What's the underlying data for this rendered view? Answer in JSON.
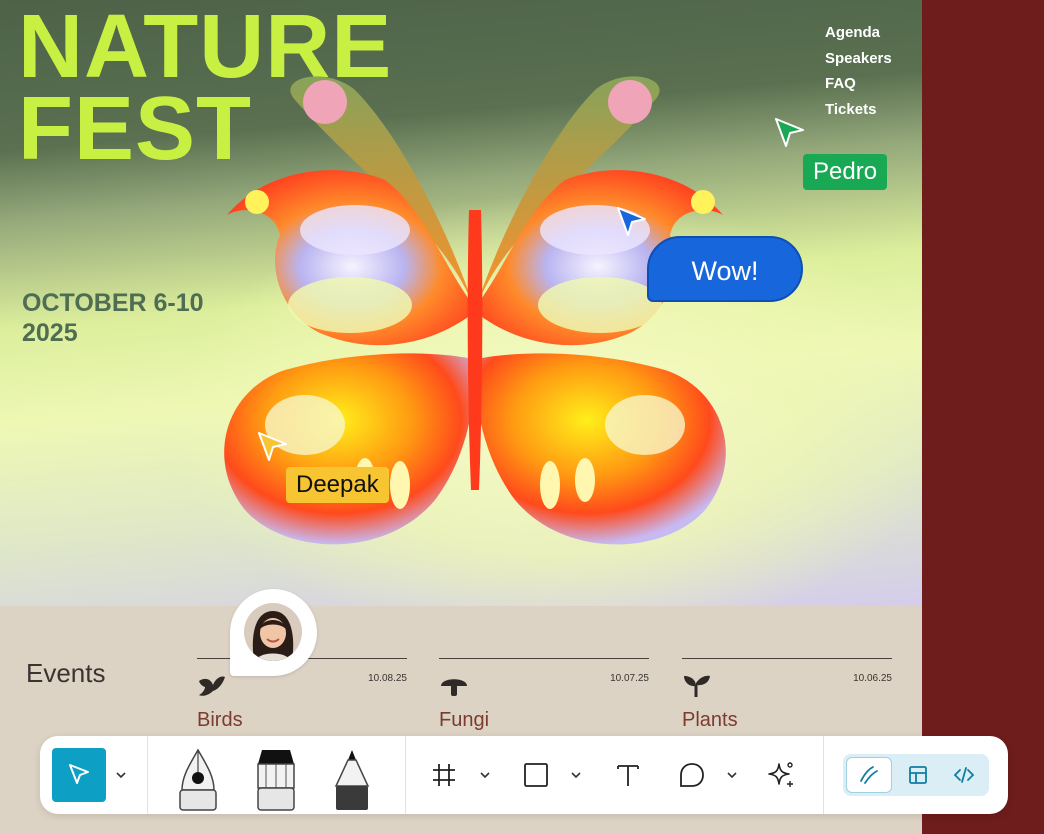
{
  "hero": {
    "title_line1": "NATURE",
    "title_line2": "FEST",
    "date_line1": "OCTOBER 6-10",
    "date_line2": "2025",
    "nav": [
      "Agenda",
      "Speakers",
      "FAQ",
      "Tickets"
    ]
  },
  "collaborators": {
    "pedro_label": "Pedro",
    "deepak_label": "Deepak",
    "comment_text": "Wow!",
    "pedro_color": "#19a854",
    "deepak_color": "#f7c531",
    "comment_color": "#1766dc"
  },
  "events": {
    "heading": "Events",
    "items": [
      {
        "name": "Birds",
        "date": "10.08.25",
        "icon": "bird-icon"
      },
      {
        "name": "Fungi",
        "date": "10.07.25",
        "icon": "mushroom-icon"
      },
      {
        "name": "Plants",
        "date": "10.06.25",
        "icon": "plant-icon"
      }
    ]
  },
  "toolbar": {
    "accent": "#0e9fc4",
    "tools": [
      "cursor-icon",
      "pen-icon",
      "brush-icon",
      "pencil-icon",
      "frame-icon",
      "rectangle-icon",
      "text-icon",
      "comment-icon",
      "ai-sparkle-icon"
    ],
    "modes": [
      "draw-mode-icon",
      "design-mode-icon",
      "dev-mode-icon"
    ]
  },
  "colors": {
    "title": "#c8f043",
    "date": "#4f6d52",
    "event_name": "#7b3b2e",
    "side_panel": "#6e1c1c"
  }
}
